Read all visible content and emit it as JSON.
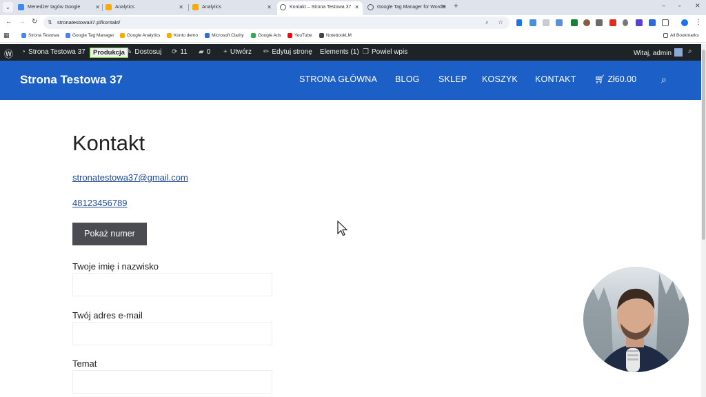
{
  "browser": {
    "tabs": [
      {
        "title": "Menedżer tagów Google",
        "color": "#4285f4"
      },
      {
        "title": "Analytics",
        "color": "#f9ab00"
      },
      {
        "title": "Analytics",
        "color": "#f9ab00"
      },
      {
        "title": "Kontakt – Strona Testowa 37",
        "color": "#555555"
      },
      {
        "title": "Google Tag Manager for WordP",
        "color": "#555555"
      }
    ],
    "url": "stronatestowa37.pl/kontakt/",
    "bookmarks": [
      {
        "label": "Strona Testowa",
        "color": "#4285f4"
      },
      {
        "label": "Google Tag Manager",
        "color": "#4285f4"
      },
      {
        "label": "Google Analytics",
        "color": "#f9ab00"
      },
      {
        "label": "Konto demo",
        "color": "#f9ab00"
      },
      {
        "label": "Microsoft Clarity",
        "color": "#2b6ee0"
      },
      {
        "label": "Google Ads",
        "color": "#34a853"
      },
      {
        "label": "YouTube",
        "color": "#ff0000"
      },
      {
        "label": "NotebookLM",
        "color": "#444444"
      }
    ],
    "all_bookmarks": "All Bookmarks"
  },
  "adminbar": {
    "site_name": "Strona Testowa 37",
    "env_badge": "Produkcja",
    "customize": "Dostosuj",
    "updates_count": "11",
    "comments_count": "0",
    "new": "Utwórz",
    "edit_page": "Edytuj stronę",
    "elements": "Elements (1)",
    "duplicate": "Powiel wpis",
    "greeting": "Witaj, admin"
  },
  "site": {
    "title": "Strona Testowa 37",
    "nav": [
      "STRONA GŁÓWNA",
      "BLOG",
      "SKLEP",
      "KOSZYK",
      "KONTAKT"
    ],
    "cart_total": "Zł60.00",
    "brand_color": "#1b5fc7"
  },
  "page": {
    "heading": "Kontakt",
    "email": "stronatestowa37@gmail.com",
    "phone": "48123456789",
    "show_number_button": "Pokaż numer",
    "form": {
      "name_label": "Twoje imię i nazwisko",
      "email_label": "Twój adres e-mail",
      "subject_label": "Temat"
    }
  }
}
